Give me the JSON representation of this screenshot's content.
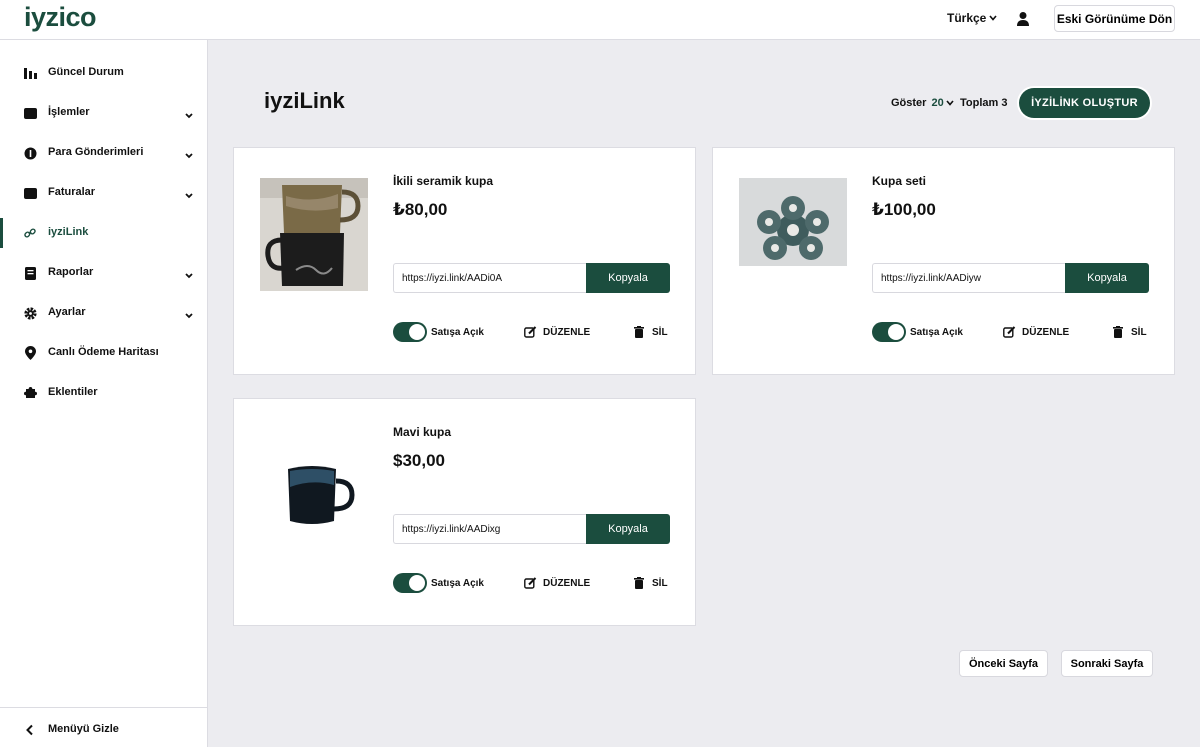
{
  "header": {
    "logo": "iyzico",
    "language": "Türkçe",
    "old_view_label": "Eski Görünüme Dön"
  },
  "sidebar": {
    "items": [
      {
        "label": "Güncel Durum",
        "icon": "bar-chart-icon"
      },
      {
        "label": "İşlemler",
        "icon": "wallet-icon"
      },
      {
        "label": "Para Gönderimleri",
        "icon": "coin-icon"
      },
      {
        "label": "Faturalar",
        "icon": "invoice-icon"
      },
      {
        "label": "iyziLink",
        "icon": "link-icon"
      },
      {
        "label": "Raporlar",
        "icon": "report-icon"
      },
      {
        "label": "Ayarlar",
        "icon": "gear-icon"
      },
      {
        "label": "Canlı Ödeme Haritası",
        "icon": "map-pin-icon"
      },
      {
        "label": "Eklentiler",
        "icon": "puzzle-icon"
      }
    ],
    "footer_label": "Menüyü Gizle"
  },
  "main": {
    "title": "iyziLink",
    "show_label": "Göster",
    "page_size": "20",
    "total_label": "Toplam 3",
    "create_button": "İYZİLİNK OLUŞTUR",
    "products": [
      {
        "name": "İkili seramik kupa",
        "price": "₺80,00",
        "link": "https://iyzi.link/AADi0A",
        "copy_label": "Kopyala",
        "sale_label": "Satışa Açık",
        "edit_label": "DÜZENLE",
        "delete_label": "SİL"
      },
      {
        "name": "Kupa seti",
        "price": "₺100,00",
        "link": "https://iyzi.link/AADiyw",
        "copy_label": "Kopyala",
        "sale_label": "Satışa Açık",
        "edit_label": "DÜZENLE",
        "delete_label": "SİL"
      },
      {
        "name": "Mavi kupa",
        "price": "$30,00",
        "link": "https://iyzi.link/AADixg",
        "copy_label": "Kopyala",
        "sale_label": "Satışa Açık",
        "edit_label": "DÜZENLE",
        "delete_label": "SİL"
      }
    ],
    "prev_page": "Önceki Sayfa",
    "next_page": "Sonraki Sayfa"
  },
  "colors": {
    "brand": "#1b4d3e",
    "background": "#ececf0"
  }
}
